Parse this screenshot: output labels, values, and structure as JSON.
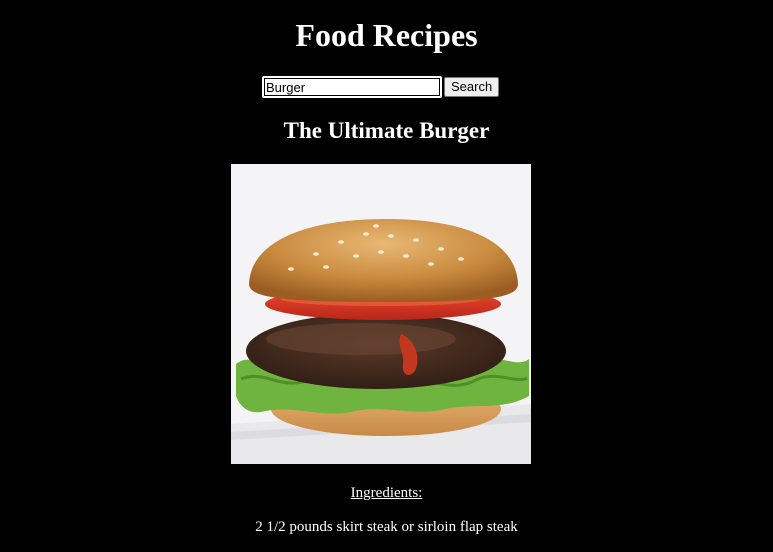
{
  "page": {
    "title": "Food Recipes"
  },
  "search": {
    "value": "Burger",
    "button_label": "Search"
  },
  "recipe": {
    "title": "The Ultimate Burger",
    "image_alt": "burger-photo",
    "ingredients_heading": "Ingredients:",
    "ingredients": [
      "2 1/2 pounds skirt steak or sirloin flap steak"
    ]
  },
  "colors": {
    "background": "#000000",
    "text": "#ffffff"
  }
}
